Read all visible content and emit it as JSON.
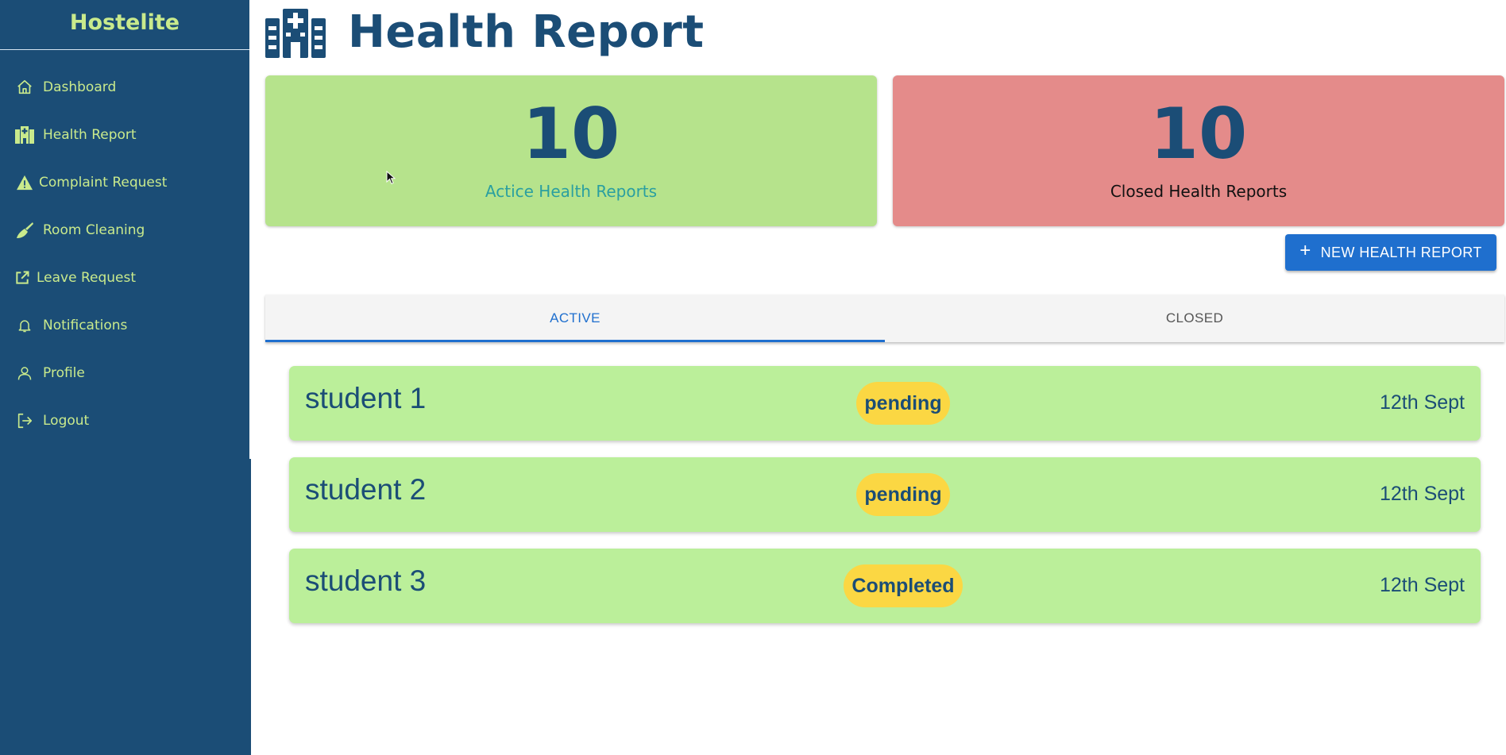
{
  "sidebar": {
    "brand": "Hostelite",
    "items": [
      {
        "label": "Dashboard",
        "icon": "home-icon"
      },
      {
        "label": "Health Report",
        "icon": "hospital-icon"
      },
      {
        "label": "Complaint Request",
        "icon": "warning-icon"
      },
      {
        "label": "Room Cleaning",
        "icon": "broom-icon"
      },
      {
        "label": "Leave Request",
        "icon": "external-link-icon"
      },
      {
        "label": "Notifications",
        "icon": "bell-icon"
      },
      {
        "label": "Profile",
        "icon": "user-icon"
      },
      {
        "label": "Logout",
        "icon": "logout-icon"
      }
    ]
  },
  "header": {
    "title": "Health Report",
    "icon": "hospital-icon"
  },
  "stats": {
    "active": {
      "count": "10",
      "label": "Actice Health Reports"
    },
    "closed": {
      "count": "10",
      "label": "Closed Health Reports"
    }
  },
  "actions": {
    "new_report_label": "NEW HEALTH REPORT"
  },
  "tabs": [
    {
      "label": "ACTIVE",
      "selected": true
    },
    {
      "label": "CLOSED",
      "selected": false
    }
  ],
  "reports": [
    {
      "name": "student 1",
      "status": "pending",
      "date": "12th Sept"
    },
    {
      "name": "student 2",
      "status": "pending",
      "date": "12th Sept"
    },
    {
      "name": "student 3",
      "status": "Completed",
      "date": "12th Sept"
    }
  ],
  "colors": {
    "sidebar_bg": "#1b4d76",
    "accent_text": "#c9ea8c",
    "active_card": "#b6e38c",
    "closed_card": "#e48b8a",
    "primary_button": "#1f6fce",
    "row_bg": "#bbef9a",
    "status_badge": "#fbd743"
  }
}
